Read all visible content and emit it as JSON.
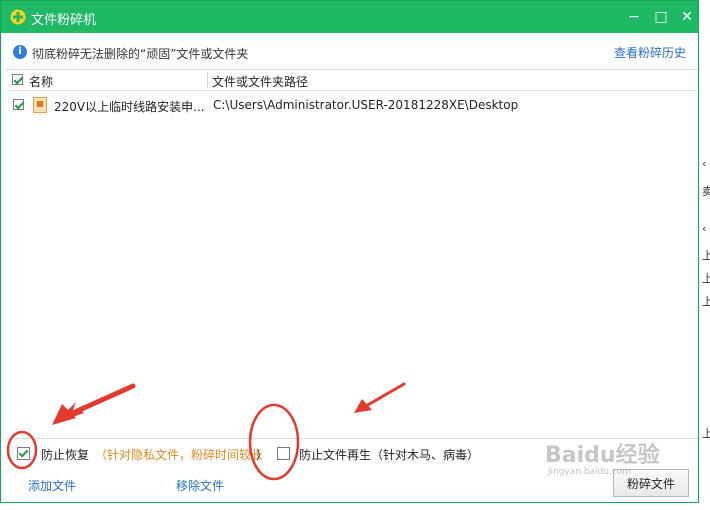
{
  "window": {
    "title": "文件粉碎机",
    "controls": {
      "minimize": "−",
      "maximize": "□",
      "close": "✕"
    }
  },
  "info": {
    "description": "彻底粉碎无法删除的“顽固”文件或文件夹",
    "history_link": "查看粉碎历史"
  },
  "table": {
    "columns": [
      "名称",
      "文件或文件夹路径"
    ],
    "rows": [
      {
        "checked": true,
        "name": "220V以上临时线路安装申...",
        "path": "C:\\Users\\Administrator.USER-20181228XE\\Desktop"
      }
    ]
  },
  "options": {
    "prevent_recovery": {
      "checked": true,
      "label": "防止恢复",
      "hint": "（针对隐私文件，粉碎时间较长",
      "hint_end": "）"
    },
    "prevent_regen": {
      "checked": false,
      "label": "防止文件再生（针对木马、病毒）"
    }
  },
  "actions": {
    "add_files": "添加文件",
    "remove_files": "移除文件",
    "shred": "粉碎文件"
  },
  "colors": {
    "titlebar": "#1fb865",
    "link": "#2a6fc9",
    "hint": "#e08a1e",
    "annotation": "#e23a2e"
  },
  "background_fragments": [
    "‹",
    "卖",
    "‹",
    "上",
    "上",
    "上",
    "上"
  ],
  "watermark": {
    "brand": "Baidu经验",
    "sub": "jingyan.baidu.com"
  }
}
